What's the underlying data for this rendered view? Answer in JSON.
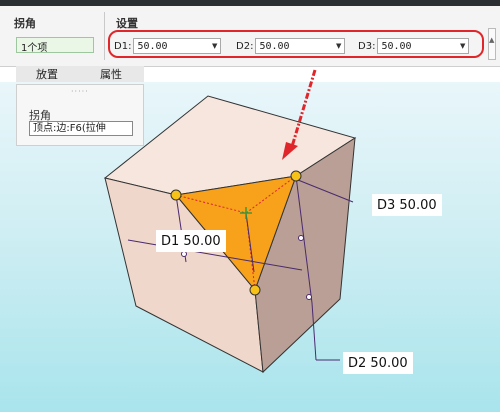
{
  "ribbon": {
    "corner_group": {
      "title": "拐角",
      "item": "1个项"
    },
    "settings_group": {
      "title": "设置",
      "d1": {
        "label": "D1:",
        "value": "50.00"
      },
      "d2": {
        "label": "D2:",
        "value": "50.00"
      },
      "d3": {
        "label": "D3:",
        "value": "50.00"
      }
    }
  },
  "tabs": [
    {
      "label": "放置"
    },
    {
      "label": "属性"
    }
  ],
  "placement_panel": {
    "title": "拐角",
    "value": "顶点:边:F6(拉伸"
  },
  "dimensions": {
    "d1": "D1 50.00",
    "d2": "D2 50.00",
    "d3": "D3 50.00"
  },
  "colors": {
    "highlight": "#e0262b",
    "cube_top": "#f7e6de",
    "cube_left": "#efd7cb",
    "cube_right": "#b99f95",
    "chamfer": "#f7a21a",
    "handle": "#f6c21a",
    "dimension_line": "#4a2a6e"
  },
  "icons": [
    "arrow-down-icon",
    "chevron-down-icon",
    "csys-marker-icon"
  ]
}
